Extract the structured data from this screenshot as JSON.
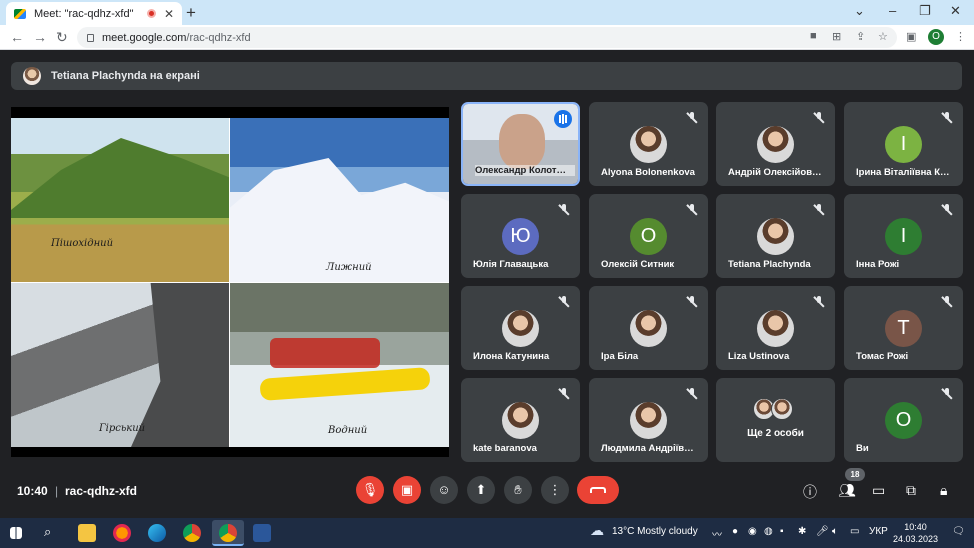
{
  "browser": {
    "tab_title": "Meet: \"rac-qdhz-xfd\"",
    "new_tab": "+",
    "url_host": "meet.google.com",
    "url_path": "/rac-qdhz-xfd",
    "profile_initial": "O",
    "window_controls": [
      "⌄",
      "–",
      "❐",
      "✕"
    ]
  },
  "meet": {
    "presenting_banner": "Tetiana Plachynda на екрані",
    "slide_labels": [
      "Пішохідний",
      "Лижний",
      "Гірський",
      "Водний"
    ],
    "participants": [
      {
        "name": "Олександр Колот…",
        "initial": "",
        "color": "",
        "type": "video",
        "muted": false
      },
      {
        "name": "Alyona Bolonenkova",
        "initial": "",
        "color": "",
        "type": "photo",
        "muted": true
      },
      {
        "name": "Андрій Олексійов…",
        "initial": "",
        "color": "",
        "type": "photo",
        "muted": true
      },
      {
        "name": "Ірина Віталіївна К…",
        "initial": "І",
        "color": "#7cb342",
        "type": "letter",
        "muted": true
      },
      {
        "name": "Юлія Главацька",
        "initial": "Ю",
        "color": "#5c6bc0",
        "type": "letter",
        "muted": true
      },
      {
        "name": "Олексій Ситник",
        "initial": "О",
        "color": "#558b2f",
        "type": "letter",
        "muted": true
      },
      {
        "name": "Tetiana Plachynda",
        "initial": "",
        "color": "",
        "type": "photo",
        "muted": true
      },
      {
        "name": "Інна Рожі",
        "initial": "І",
        "color": "#2e7d32",
        "type": "letter",
        "muted": true
      },
      {
        "name": "Илона Катунина",
        "initial": "",
        "color": "",
        "type": "photo",
        "muted": true
      },
      {
        "name": "Іра Біла",
        "initial": "",
        "color": "",
        "type": "photo",
        "muted": true
      },
      {
        "name": "Liza Ustinova",
        "initial": "",
        "color": "",
        "type": "photo",
        "muted": true
      },
      {
        "name": "Томас Рожі",
        "initial": "Т",
        "color": "#795548",
        "type": "letter",
        "muted": true
      },
      {
        "name": "kate baranova",
        "initial": "",
        "color": "",
        "type": "photo",
        "muted": true
      },
      {
        "name": "Людмила Андріїв…",
        "initial": "",
        "color": "",
        "type": "photo",
        "muted": true
      },
      {
        "name": "Ще 2 особи",
        "initial": "",
        "color": "",
        "type": "more",
        "muted": false
      },
      {
        "name": "Ви",
        "initial": "О",
        "color": "#2e7d32",
        "type": "letter",
        "muted": true
      }
    ],
    "time": "10:40",
    "separator": "|",
    "meeting_code": "rac-qdhz-xfd",
    "people_count": "18",
    "colors": {
      "end_call": "#ea4335",
      "tile": "#3c4043",
      "background": "#202124"
    }
  },
  "taskbar": {
    "weather": "13°C  Mostly cloudy",
    "language": "УКР",
    "clock_time": "10:40",
    "clock_date": "24.03.2023"
  }
}
